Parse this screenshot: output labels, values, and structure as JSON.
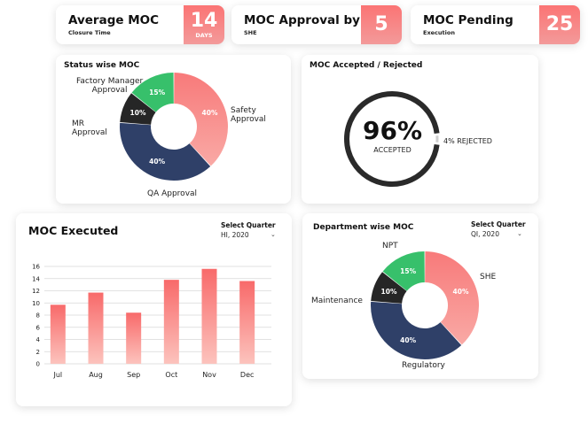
{
  "kpis": {
    "avg_moc": {
      "title": "Average MOC",
      "subtitle": "Closure Time",
      "value": "14",
      "unit": "DAYS"
    },
    "approval": {
      "title": "MOC Approval by",
      "subtitle": "SHE",
      "value": "5"
    },
    "pending": {
      "title": "MOC Pending",
      "subtitle": "Execution",
      "value": "25"
    }
  },
  "status_card": {
    "title": "Status wise MOC",
    "labels": {
      "factory": "Factory Manager\nApproval",
      "mr": "MR\nApproval",
      "safety": "Safety\nApproval",
      "qa": "QA Approval"
    }
  },
  "accepted_card": {
    "title": "MOC Accepted / Rejected",
    "percent": "96%",
    "caption": "ACCEPTED",
    "rejected": "4% REJECTED",
    "accepted_fraction": 0.96
  },
  "executed_card": {
    "title": "MOC Executed",
    "quarter_label": "Select Quarter",
    "quarter_value": "HI, 2020"
  },
  "dept_card": {
    "title": "Department wise MOC",
    "quarter_label": "Select Quarter",
    "quarter_value": "QI, 2020",
    "labels": {
      "npt": "NPT",
      "maintenance": "Maintenance",
      "she": "SHE",
      "regulatory": "Regulatory"
    }
  },
  "colors": {
    "coral": "#f87a7a",
    "coral_light": "#f9a9a5",
    "navy": "#2f4068",
    "green": "#37c06b",
    "dark": "#262626"
  },
  "chart_data": [
    {
      "type": "pie",
      "title": "Status wise MOC",
      "categories": [
        "Safety Approval",
        "QA Approval",
        "MR Approval",
        "Factory Manager Approval"
      ],
      "values": [
        40,
        40,
        10,
        15
      ],
      "value_labels": [
        "40%",
        "40%",
        "10%",
        "15%"
      ],
      "colors": [
        "#f87a7a",
        "#2f4068",
        "#262626",
        "#37c06b"
      ]
    },
    {
      "type": "bar",
      "title": "MOC Executed",
      "categories": [
        "Jul",
        "Aug",
        "Sep",
        "Oct",
        "Nov",
        "Dec"
      ],
      "values": [
        9.7,
        11.7,
        8.4,
        13.8,
        15.6,
        13.6
      ],
      "yticks": [
        0,
        2,
        4,
        6,
        8,
        10,
        12,
        14,
        16
      ],
      "ylim": [
        0,
        16
      ],
      "grid": true
    },
    {
      "type": "pie",
      "title": "Department wise MOC",
      "categories": [
        "SHE",
        "Regulatory",
        "Maintenance",
        "NPT"
      ],
      "values": [
        40,
        40,
        10,
        15
      ],
      "value_labels": [
        "40%",
        "40%",
        "10%",
        "15%"
      ],
      "colors": [
        "#f87a7a",
        "#2f4068",
        "#262626",
        "#37c06b"
      ]
    }
  ]
}
